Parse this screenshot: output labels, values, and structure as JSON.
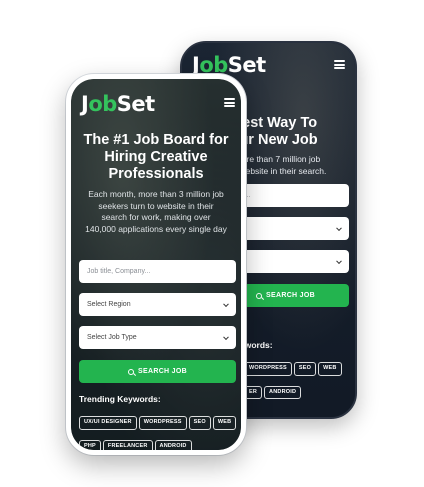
{
  "back_phone": {
    "logo": {
      "first": "J",
      "accent": "ob",
      "rest": "Set"
    },
    "headline": "asiest Way To\nYour New Job",
    "subtext": ", more than 7 million job\nto website in their search.",
    "field_1_placeholder": "pany...",
    "field_2_value": "",
    "field_3_value": "e",
    "search_label": "SEARCH JOB",
    "keywords_title": "ywords:",
    "keywords": [
      "WORDPRESS",
      "SEO",
      "WEB",
      "ER",
      "ANDROID"
    ]
  },
  "front_phone": {
    "logo": {
      "first": "J",
      "accent": "ob",
      "rest": "Set"
    },
    "headline": "The #1 Job Board for Hiring Creative Professionals",
    "subtext": "Each month, more than 3 million job seekers turn to website in their search for work, making over 140,000 applications every single day",
    "search_placeholder": "Job title, Company...",
    "region_label": "Select Region",
    "jobtype_label": "Select Job Type",
    "search_label": "SEARCH JOB",
    "keywords_title": "Trending Keywords:",
    "keywords": [
      "UX/UI DESIGNER",
      "WORDPRESS",
      "SEO",
      "WEB",
      "PHP",
      "FREELANCER",
      "ANDROID"
    ]
  },
  "colors": {
    "accent": "#23b44f",
    "logo_green": "#34c35d",
    "dark_bg": "#0f1724"
  },
  "icons": [
    "hamburger-menu-icon",
    "search-icon",
    "chevron-down-icon"
  ]
}
